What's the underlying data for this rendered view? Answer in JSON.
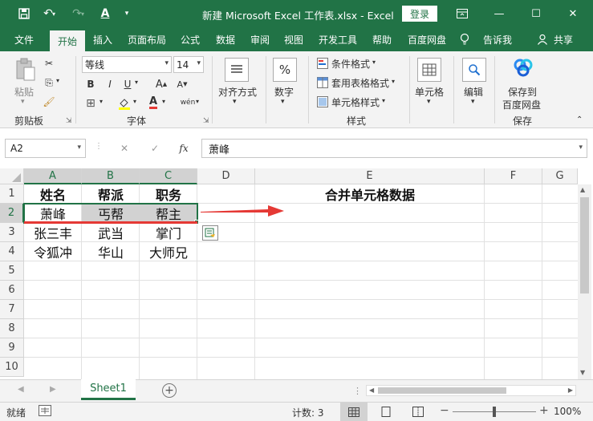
{
  "window": {
    "title": "新建 Microsoft Excel 工作表.xlsx  -  Excel",
    "login_label": "登录",
    "qat": {
      "save_icon": "save-icon",
      "undo_icon": "undo-icon",
      "redo_icon": "redo-icon",
      "font_color_icon": "font-color-icon",
      "customize_icon": "chevron-down-icon"
    },
    "controls": [
      "ribbon-display-icon",
      "minimize-icon",
      "restore-icon",
      "close-icon"
    ]
  },
  "ribbon_tabs": [
    "文件",
    "开始",
    "插入",
    "页面布局",
    "公式",
    "数据",
    "审阅",
    "视图",
    "开发工具",
    "帮助",
    "百度网盘",
    "告诉我",
    "共享"
  ],
  "active_tab": "开始",
  "ribbon": {
    "clipboard": {
      "paste": "粘贴",
      "group": "剪贴板"
    },
    "font": {
      "name": "等线",
      "size": "14",
      "bold": "B",
      "italic": "I",
      "underline": "U",
      "grow": "A",
      "shrink": "A",
      "wen": "wén",
      "group": "字体"
    },
    "alignment": {
      "label": "对齐方式"
    },
    "number": {
      "label": "数字",
      "glyph": "%"
    },
    "styles": {
      "conditional": "条件格式",
      "table_format": "套用表格格式",
      "cell_styles": "单元格样式",
      "group": "样式"
    },
    "cells": {
      "label": "单元格"
    },
    "editing": {
      "label": "编辑"
    },
    "save": {
      "line1": "保存到",
      "line2": "百度网盘",
      "group": "保存"
    }
  },
  "formula_bar": {
    "name_box": "A2",
    "fx": "fx",
    "content": "萧峰"
  },
  "columns": [
    "A",
    "B",
    "C",
    "D",
    "E",
    "F",
    "G"
  ],
  "rows": [
    "1",
    "2",
    "3",
    "4",
    "5",
    "6",
    "7",
    "8",
    "9",
    "10"
  ],
  "cells": {
    "header": [
      "姓名",
      "帮派",
      "职务"
    ],
    "r2": [
      "萧峰",
      "丐帮",
      "帮主"
    ],
    "r3": [
      "张三丰",
      "武当",
      "掌门"
    ],
    "r4": [
      "令狐冲",
      "华山",
      "大师兄"
    ],
    "e1": "合并单元格数据"
  },
  "sheets": [
    "Sheet1"
  ],
  "status": {
    "ready": "就绪",
    "count": "计数: 3",
    "zoom": "100%"
  },
  "colors": {
    "accent": "#217346",
    "selection": "#d2d2d2",
    "arrow": "#e53935",
    "underline": "#e53935"
  }
}
